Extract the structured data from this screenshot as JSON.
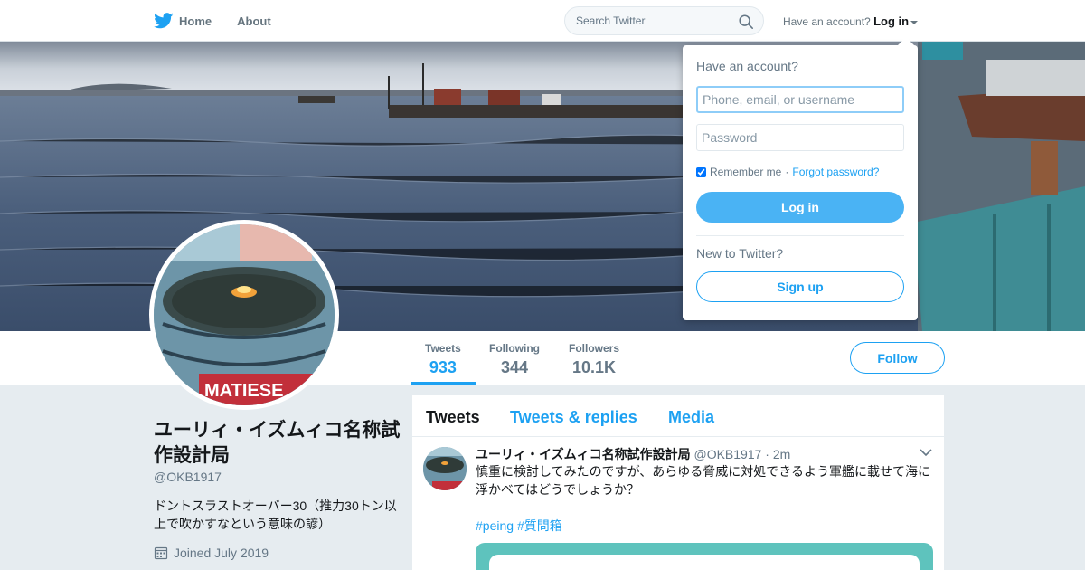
{
  "nav": {
    "home_label": "Home",
    "about_label": "About",
    "search_placeholder": "Search Twitter",
    "account_prompt": "Have an account?",
    "login_label": "Log in"
  },
  "login_dropdown": {
    "title": "Have an account?",
    "username_placeholder": "Phone, email, or username",
    "password_placeholder": "Password",
    "remember_label": "Remember me",
    "separator": "·",
    "forgot_label": "Forgot password?",
    "login_button": "Log in",
    "new_prompt": "New to Twitter?",
    "signup_button": "Sign up"
  },
  "profile_nav": {
    "stats": [
      {
        "label": "Tweets",
        "value": "933"
      },
      {
        "label": "Following",
        "value": "344"
      },
      {
        "label": "Followers",
        "value": "10.1K"
      }
    ],
    "follow_button": "Follow"
  },
  "profile": {
    "name": "ユーリィ・イズムィコ名称試作設計局",
    "handle": "@OKB1917",
    "bio": "ドントスラストオーバー30（推力30トン以上で吹かすなという意味の諺）",
    "joined": "Joined July 2019",
    "avatar_text": "MATIESE"
  },
  "timeline": {
    "tabs": [
      "Tweets",
      "Tweets & replies",
      "Media"
    ],
    "tweet": {
      "name": "ユーリィ・イズムィコ名称試作設計局",
      "handle": "@OKB1917",
      "time": "· 2m",
      "text": "慎重に検討してみたのですが、あらゆる脅威に対処できるよう軍艦に載せて海に浮かべてはどうでしょうか？",
      "hashtags": [
        "#peing",
        "#質問箱"
      ]
    }
  },
  "colors": {
    "accent": "#1da1f2",
    "login_button": "#4ab3f4",
    "background": "#e6ecf0",
    "card_teal": "#5ec3bd"
  },
  "icons": {
    "logo": "twitter-bird-icon",
    "search": "search-icon",
    "calendar": "calendar-icon",
    "menu": "chevron-down-icon"
  }
}
